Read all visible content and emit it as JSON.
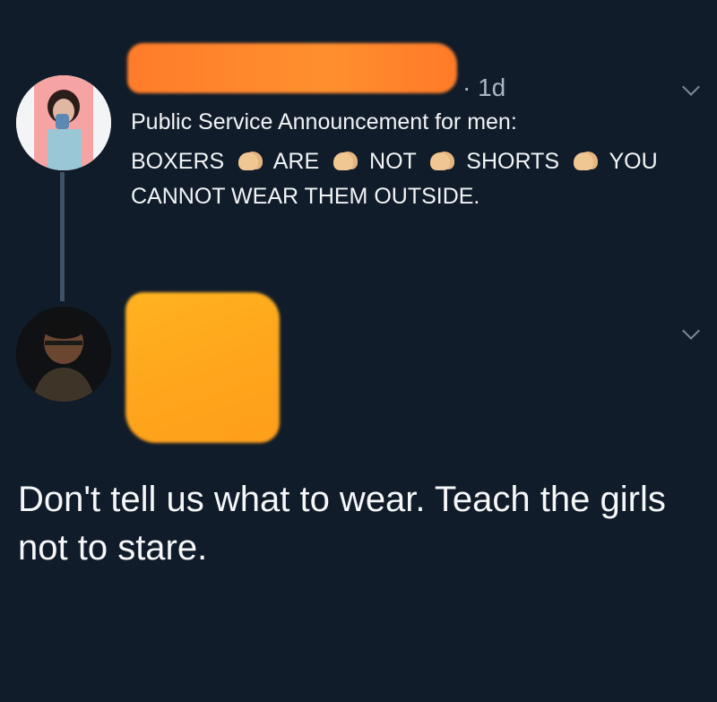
{
  "tweet": {
    "time": "1d",
    "time_separator": "·",
    "line1": "Public Service Announcement for men:",
    "words": [
      "BOXERS",
      "ARE",
      "NOT",
      "SHORTS",
      "YOU"
    ],
    "line3": "CANNOT WEAR THEM OUTSIDE.",
    "clap_icon": "clapping-hands-icon"
  },
  "reply": {
    "text": "Don't tell us what to wear. Teach the girls not to stare."
  },
  "colors": {
    "background": "#101c29",
    "redact_orange": "#ff8a2e",
    "redact_yellow": "#ffab1e",
    "text": "#f1f4f6",
    "muted": "#aab6c2"
  }
}
